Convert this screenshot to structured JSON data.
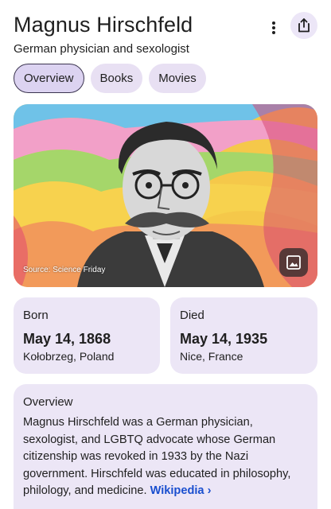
{
  "header": {
    "title": "Magnus Hirschfeld",
    "subtitle": "German physician and sexologist"
  },
  "tabs": [
    {
      "label": "Overview",
      "active": true
    },
    {
      "label": "Books",
      "active": false
    },
    {
      "label": "Movies",
      "active": false
    }
  ],
  "hero": {
    "source": "Source: Science Friday"
  },
  "born": {
    "label": "Born",
    "date": "May 14, 1868",
    "place": "Kołobrzeg, Poland"
  },
  "died": {
    "label": "Died",
    "date": "May 14, 1935",
    "place": "Nice, France"
  },
  "overview": {
    "label": "Overview",
    "text": "Magnus Hirschfeld was a German physician, sexologist, and LGBTQ advocate whose German citizenship was revoked in 1933 by the Nazi government. Hirschfeld was educated in philosophy, philology, and medicine. ",
    "link": "Wikipedia ›"
  },
  "colors": {
    "chip_bg": "#e8e0f3",
    "card_bg": "#ece6f6",
    "link": "#1a4fcf"
  }
}
